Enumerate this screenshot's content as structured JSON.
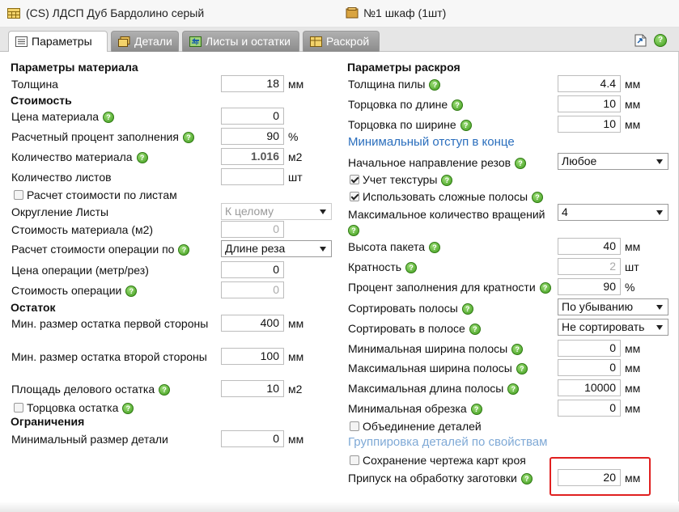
{
  "header": {
    "material_title": "(CS) ЛДСП Дуб Бардолино серый",
    "order_title": "№1 шкаф (1шт)"
  },
  "tabs": [
    "Параметры",
    "Детали",
    "Листы и остатки",
    "Раскрой"
  ],
  "left": {
    "material_section": "Параметры материала",
    "thickness_label": "Толщина",
    "thickness_value": "18",
    "thickness_unit": "мм",
    "cost_section": "Стоимость",
    "price_label": "Цена материала",
    "price_value": "0",
    "fill_label": "Расчетный процент заполнения",
    "fill_value": "90",
    "fill_unit": "%",
    "qty_label": "Количество материала",
    "qty_value": "1.016",
    "qty_unit": "м2",
    "sheets_label": "Количество листов",
    "sheets_value": "",
    "sheets_unit": "шт",
    "per_sheet_label": "Расчет стоимости по листам",
    "round_label": "Округление Листы",
    "round_value": "К целому",
    "mat_cost_label": "Стоимость материала (м2)",
    "mat_cost_value": "0",
    "op_calc_label": "Расчет стоимости операции по",
    "op_calc_value": "Длине реза",
    "op_price_label": "Цена операции (метр/рез)",
    "op_price_value": "0",
    "op_cost_label": "Стоимость операции",
    "op_cost_value": "0",
    "remnant_section": "Остаток",
    "rem1_label": "Мин. размер остатка первой стороны",
    "rem1_value": "400",
    "rem1_unit": "мм",
    "rem2_label": "Мин. размер остатка второй стороны",
    "rem2_value": "100",
    "rem2_unit": "мм",
    "area_label": "Площадь делового остатка",
    "area_value": "10",
    "area_unit": "м2",
    "trim_label": "Торцовка остатка",
    "limits_section": "Ограничения",
    "min_part_label": "Минимальный размер детали",
    "min_part_value": "0",
    "min_part_unit": "мм"
  },
  "right": {
    "cut_section": "Параметры раскроя",
    "saw_label": "Толщина пилы",
    "saw_value": "4.4",
    "saw_unit": "мм",
    "trim_len_label": "Торцовка по длине",
    "trim_len_value": "10",
    "trim_len_unit": "мм",
    "trim_wid_label": "Торцовка по ширине",
    "trim_wid_value": "10",
    "trim_wid_unit": "мм",
    "min_offset_link": "Минимальный отступ в конце",
    "dir_label": "Начальное направление резов",
    "dir_value": "Любое",
    "texture_label": "Учет текстуры",
    "complex_label": "Использовать сложные полосы",
    "rot_label": "Максимальное количество вращений",
    "rot_value": "4",
    "stack_label": "Высота пакета",
    "stack_value": "40",
    "stack_unit": "мм",
    "mult_label": "Кратность",
    "mult_value": "2",
    "mult_unit": "шт",
    "fill_mult_label": "Процент заполнения для кратности",
    "fill_mult_value": "90",
    "fill_mult_unit": "%",
    "sort_strips_label": "Сортировать полосы",
    "sort_strips_value": "По убыванию",
    "sort_in_label": "Сортировать в полосе",
    "sort_in_value": "Не сортировать",
    "min_strip_label": "Минимальная ширина полосы",
    "min_strip_value": "0",
    "min_strip_unit": "мм",
    "max_strip_label": "Максимальная ширина полосы",
    "max_strip_value": "0",
    "max_strip_unit": "мм",
    "max_len_label": "Максимальная длина полосы",
    "max_len_value": "10000",
    "max_len_unit": "мм",
    "min_scrap_label": "Минимальная обрезка",
    "min_scrap_value": "0",
    "min_scrap_unit": "мм",
    "merge_label": "Объединение деталей",
    "group_link": "Группировка деталей по свойствам",
    "save_label": "Сохранение чертежа карт кроя",
    "allowance_label": "Припуск на обработку заготовки",
    "allowance_value": "20",
    "allowance_unit": "мм"
  },
  "icons": {
    "hint": "?"
  }
}
